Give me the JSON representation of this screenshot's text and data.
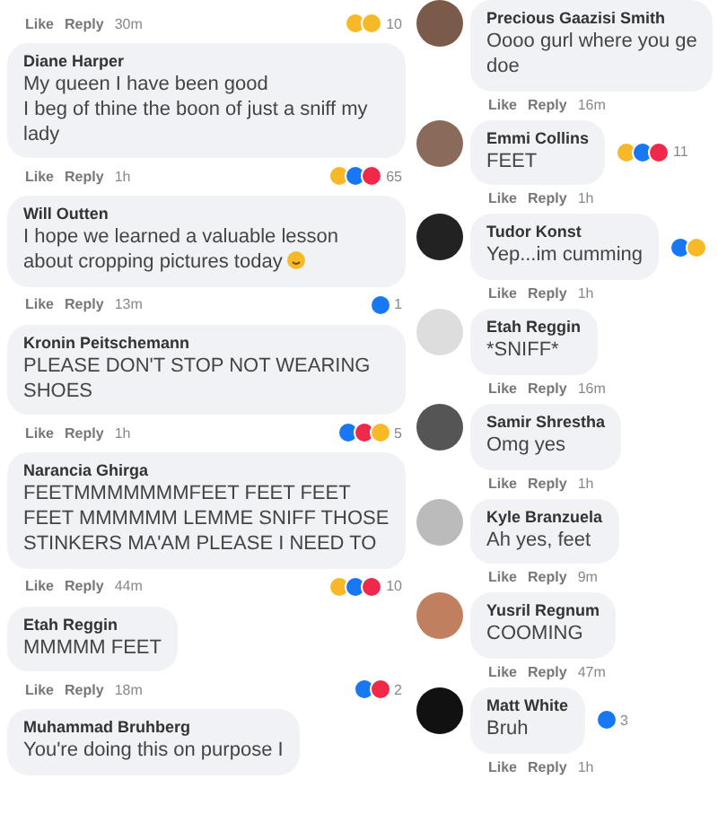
{
  "left_comments": [
    {
      "reactions": [
        {
          "kind": "haha"
        },
        {
          "kind": "wow"
        }
      ],
      "count": "10",
      "actions": [
        "Like",
        "Reply"
      ],
      "time": "30m"
    },
    {
      "name": "Diane Harper",
      "text": "My queen I have been good\nI beg of thine the boon of just a sniff my lady",
      "reactions": [
        {
          "kind": "haha"
        },
        {
          "kind": "like"
        },
        {
          "kind": "love"
        }
      ],
      "count": "65",
      "actions": [
        "Like",
        "Reply"
      ],
      "time": "1h"
    },
    {
      "name": "Will Outten",
      "text": "I hope we learned a valuable lesson about cropping pictures today",
      "emoji": true,
      "reactions": [
        {
          "kind": "like"
        }
      ],
      "count": "1",
      "actions": [
        "Like",
        "Reply"
      ],
      "time": "13m"
    },
    {
      "name": "Kronin Peitschemann",
      "text": "PLEASE DON'T STOP NOT WEARING SHOES",
      "reactions": [
        {
          "kind": "like"
        },
        {
          "kind": "love"
        },
        {
          "kind": "haha"
        }
      ],
      "count": "5",
      "actions": [
        "Like",
        "Reply"
      ],
      "time": "1h"
    },
    {
      "name": "Narancia Ghirga",
      "text": "FEETMMMMMMMFEET FEET FEET FEET MMMMMM LEMME SNIFF THOSE STINKERS MA'AM PLEASE I NEED TO",
      "reactions": [
        {
          "kind": "haha"
        },
        {
          "kind": "like"
        },
        {
          "kind": "love"
        }
      ],
      "count": "10",
      "actions": [
        "Like",
        "Reply"
      ],
      "time": "44m"
    },
    {
      "name": "Etah Reggin",
      "text": "MMMMM FEET",
      "reactions": [
        {
          "kind": "like"
        },
        {
          "kind": "love"
        }
      ],
      "count": "2",
      "actions": [
        "Like",
        "Reply"
      ],
      "time": "18m"
    },
    {
      "name": "Muhammad Bruhberg",
      "text": "You're doing this on purpose I"
    }
  ],
  "right_comments": [
    {
      "name": "Precious Gaazisi Smith",
      "text": "Oooo gurl where you ge\ndoe",
      "actions": [
        "Like",
        "Reply"
      ],
      "time": "16m"
    },
    {
      "name": "Emmi Collins",
      "text": "FEET",
      "reactions": [
        {
          "kind": "haha"
        },
        {
          "kind": "like"
        },
        {
          "kind": "love"
        }
      ],
      "count": "11",
      "actions": [
        "Like",
        "Reply"
      ],
      "time": "1h"
    },
    {
      "name": "Tudor Konst",
      "text": "Yep...im cumming",
      "reactions": [
        {
          "kind": "like"
        },
        {
          "kind": "haha"
        }
      ],
      "actions": [
        "Like",
        "Reply"
      ],
      "time": "1h"
    },
    {
      "name": "Etah Reggin",
      "text": "*SNIFF*",
      "actions": [
        "Like",
        "Reply"
      ],
      "time": "16m"
    },
    {
      "name": "Samir Shrestha",
      "text": "Omg yes",
      "actions": [
        "Like",
        "Reply"
      ],
      "time": "1h"
    },
    {
      "name": "Kyle Branzuela",
      "text": "Ah yes, feet",
      "actions": [
        "Like",
        "Reply"
      ],
      "time": "9m"
    },
    {
      "name": "Yusril Regnum",
      "text": "COOMING",
      "actions": [
        "Like",
        "Reply"
      ],
      "time": "47m"
    },
    {
      "name": "Matt White",
      "text": "Bruh",
      "reactions": [
        {
          "kind": "like"
        }
      ],
      "count": "3",
      "actions": [
        "Like",
        "Reply"
      ],
      "time": "1h"
    }
  ]
}
